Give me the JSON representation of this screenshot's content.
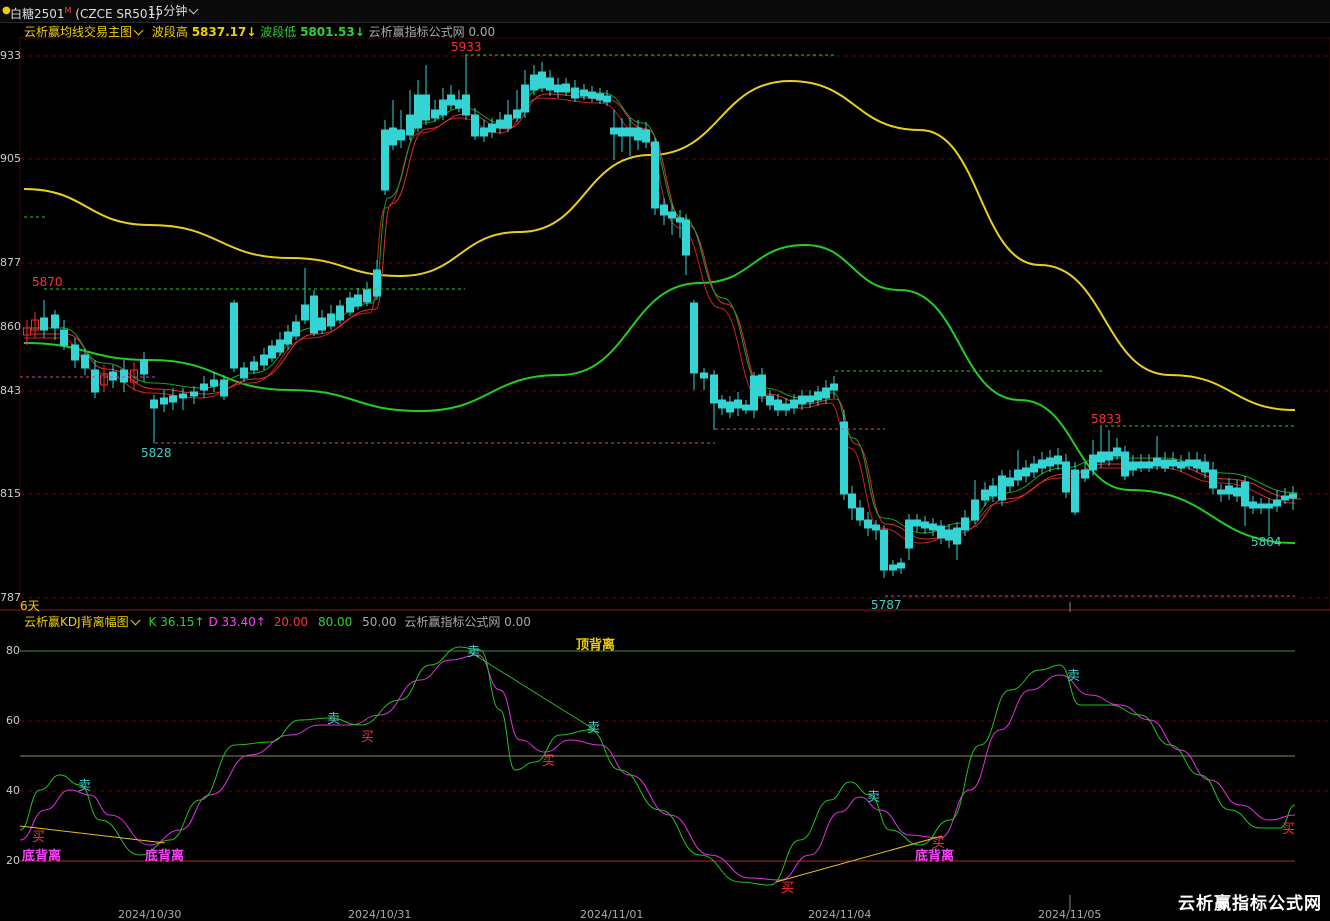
{
  "header": {
    "symbol_name": "白糖2501",
    "symbol_sup": "M",
    "symbol_code": "(CZCE SR501)",
    "period": "15分钟"
  },
  "main_indicator": {
    "name": "云析赢均线交易主图",
    "wave_high_label": "波段高",
    "wave_high_value": "5837.17↓",
    "wave_low_label": "波段低",
    "wave_low_value": "5801.53↓",
    "formula_site": "云析赢指标公式网",
    "formula_value": "0.00"
  },
  "main_axis": {
    "ticks": [
      "933",
      "905",
      "877",
      "860",
      "843",
      "815",
      "787"
    ],
    "tick_values": [
      5933,
      5905,
      5877,
      5860,
      5843,
      5815,
      5787
    ]
  },
  "annotations": {
    "peak_5933": "5933",
    "peak_5870": "5870",
    "low_5828": "5828",
    "peak_5833": "5833",
    "low_5804": "5804",
    "low_5787": "5787",
    "days": "6天"
  },
  "kdj": {
    "name": "云析赢KDJ背离幅图",
    "k_label": "K",
    "k_value": "36.15↑",
    "d_label": "D",
    "d_value": "33.40↑",
    "level1": "20.00",
    "level2": "80.00",
    "level3": "50.00",
    "formula_site": "云析赢指标公式网",
    "formula_value": "0.00",
    "top_divergence": "顶背离",
    "bottom_divergence": "底背离",
    "ticks": [
      "80",
      "60",
      "40",
      "20"
    ],
    "sell": "卖",
    "buy": "买"
  },
  "dates": [
    "2024/10/30",
    "2024/10/31",
    "2024/11/01",
    "2024/11/04",
    "2024/11/05"
  ],
  "colors": {
    "up": "#ff2a2a",
    "down": "#35d4d4",
    "ma_yellow": "#e8d020",
    "ma_green": "#22cc22",
    "grid": "#5a0a0a"
  },
  "watermark": "云析赢指标公式网"
}
